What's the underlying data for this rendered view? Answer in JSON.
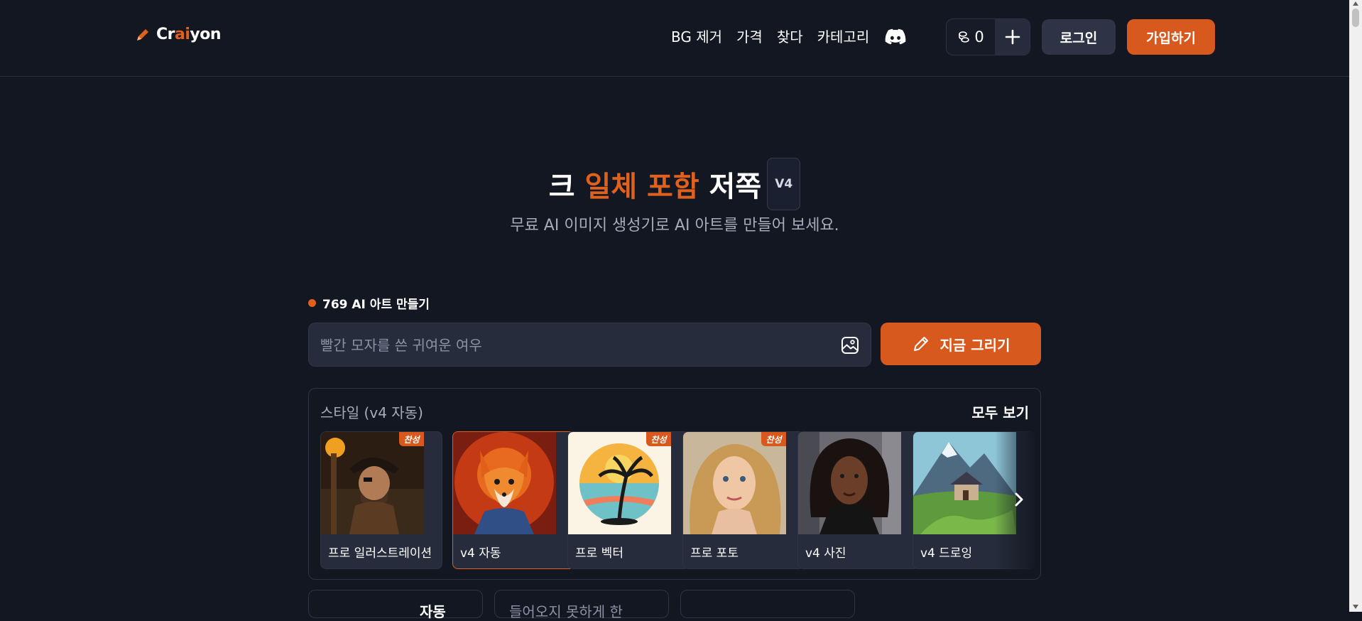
{
  "header": {
    "logo_pre": "Cr",
    "logo_ai": "ai",
    "logo_post": "yon",
    "nav": [
      "BG 제거",
      "가격",
      "찾다",
      "카테고리"
    ],
    "credits": "0",
    "login": "로그인",
    "signup": "가입하기"
  },
  "hero": {
    "title_a": "크",
    "title_b": "일체 포함",
    "title_c": "저쪽",
    "badge": "V4",
    "subtitle": "무료 AI 이미지 생성기로 AI 아트를 만들어 보세요."
  },
  "count_label": "769 AI 아트 만들기",
  "prompt": {
    "placeholder": "빨간 모자를 쓴 귀여운 여우"
  },
  "draw_button": "지금 그리기",
  "styles": {
    "label": "스타일 (v4 자동)",
    "view_all": "모두 보기",
    "items": [
      {
        "label": "프로 일러스트레이션",
        "badge": "찬성"
      },
      {
        "label": "v4 자동",
        "badge": ""
      },
      {
        "label": "프로 벡터",
        "badge": "찬성"
      },
      {
        "label": "프로 포토",
        "badge": "찬성"
      },
      {
        "label": "v4 사진",
        "badge": ""
      },
      {
        "label": "v4 드로잉",
        "badge": ""
      }
    ]
  },
  "bottom": {
    "box1": "자동",
    "box2": "들어오지 못하게 한"
  },
  "colors": {
    "accent": "#d8591d",
    "background": "#131722"
  }
}
